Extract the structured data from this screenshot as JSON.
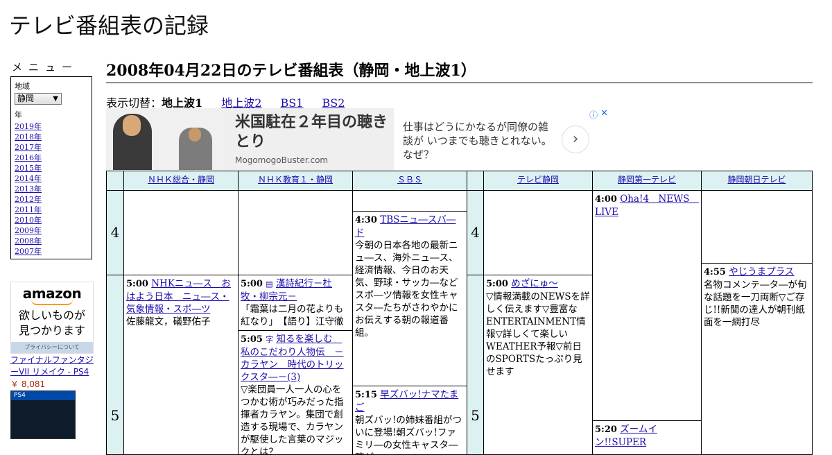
{
  "site": {
    "title": "テレビ番組表の記録"
  },
  "sidebar": {
    "menu_title": "メニュー",
    "region_label": "地域",
    "region_value": "静岡",
    "year_label": "年",
    "years": [
      "2019年",
      "2018年",
      "2017年",
      "2016年",
      "2015年",
      "2014年",
      "2013年",
      "2012年",
      "2011年",
      "2010年",
      "2009年",
      "2008年",
      "2007年"
    ]
  },
  "side_ad": {
    "logo": "amazon",
    "tagline_1": "欲しいものが",
    "tagline_2": "見つかります",
    "privacy": "プライバシーについて",
    "product_title": "ファイナルファンタジーVII リメイク - PS4",
    "price": "￥ 8,081",
    "product_badge": "PS4"
  },
  "main": {
    "heading": "2008年04月22日のテレビ番組表（静岡・地上波1）",
    "switch_label": "表示切替：",
    "switch_current": "地上波1",
    "switch_links": [
      "地上波2",
      "BS1",
      "BS2"
    ]
  },
  "banner_ad": {
    "headline": "米国駐在２年目の聴きとり",
    "domain": "MogomogoBuster.com",
    "description": "仕事はどうにかなるが同僚の雑談が いつまでも聴きとれない。なぜ？",
    "next": "›",
    "info": "ⓘ",
    "close": "✕"
  },
  "schedule": {
    "channels": [
      "ＮＨＫ総合・静岡",
      "ＮＨＫ教育１・静岡",
      "ＳＢＳ",
      "テレビ静岡",
      "静岡第一テレビ",
      "静岡朝日テレビ"
    ],
    "hours": [
      "4",
      "5"
    ],
    "programs": {
      "nhk_sogo_500": {
        "time": "5:00",
        "title": "NHKニュ―ス　おはよう日本　ニュ―ス・気象情報・スポ―ツ",
        "desc": "佐藤龍文，礒野佑子"
      },
      "nhk_edu_500": {
        "time": "5:00",
        "title": "漢詩紀行－杜牧・柳宗元－",
        "desc": "「霜葉は二月の花よりも紅なり」　【語り】江守徹"
      },
      "nhk_edu_505": {
        "time": "5:05",
        "title": "知るを楽しむ　私のこだわり人物伝　－カラヤン　時代のトリックスタ―－(3)",
        "desc": "▽楽団員一人一人の心をつかむ術が巧みだった指揮者カラヤン。集団で創造する現場で、カラヤンが駆使した言葉のマジックとは？"
      },
      "sbs_430": {
        "time": "4:30",
        "title": "TBSニュ―スバ―ド",
        "desc": "今朝の日本各地の最新ニュ―ス、海外ニュ―ス、経済情報、今日のお天気、野球・サッカ―などスポ―ツ情報を女性キャスタ―たちがさわやかにお伝えする朝の報道番組。"
      },
      "sbs_515": {
        "time": "5:15",
        "title": "早ズバッ!ナマたまご",
        "desc": "朝ズバッ!の姉妹番組がついに登場!朝ズバッ!ファミリ―の女性キャスタ―陣が"
      },
      "sut_500": {
        "time": "5:00",
        "title": "めざにゅ～",
        "desc": "▽情報満載のNEWSを詳しく伝えます▽豊富なENTERTAINMENT情報▽詳しくて楽しいWEATHER予報▽前日のSPORTSたっぷり見せます"
      },
      "daiichi_400": {
        "time": "4:00",
        "title": "Oha!4　NEWS　LIVE",
        "desc": ""
      },
      "daiichi_520": {
        "time": "5:20",
        "title": "ズームイン!!SUPER",
        "desc": ""
      },
      "asahi_455": {
        "time": "4:55",
        "title": "やじうまプラス",
        "desc": "名物コメンテ―タ―が旬な話題を一刀両断▽ご存じ!!新聞の達人が朝刊紙面を一網打尽"
      }
    }
  },
  "icons": {
    "epg_icon_1": "▤",
    "epg_icon_2": "字",
    "select_arrow": "▼"
  }
}
